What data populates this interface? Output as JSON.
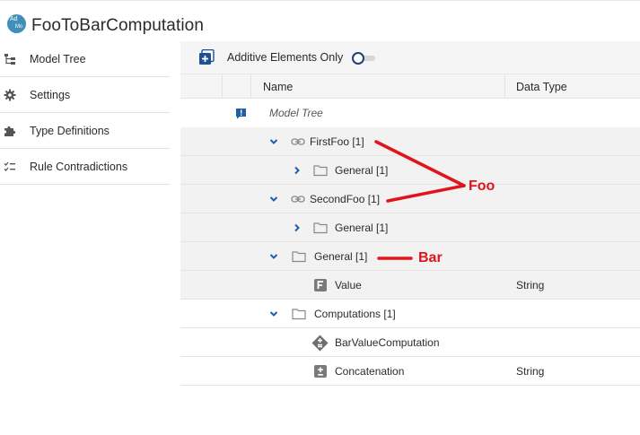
{
  "app": {
    "logo_line1": "Ad",
    "logo_line2": "Mo",
    "title": "FooToBarComputation"
  },
  "sidebar": {
    "items": [
      {
        "label": "Model Tree",
        "icon": "model-tree-icon"
      },
      {
        "label": "Settings",
        "icon": "gear-icon"
      },
      {
        "label": "Type Definitions",
        "icon": "puzzle-icon"
      },
      {
        "label": "Rule Contradictions",
        "icon": "checklist-icon"
      }
    ]
  },
  "toolbar": {
    "add_icon": "add-element-icon",
    "additive_label": "Additive Elements Only",
    "additive_enabled": false
  },
  "table": {
    "columns": {
      "name": "Name",
      "data_type": "Data Type"
    },
    "rows": [
      {
        "name": "Model Tree",
        "icon": "info-badge-icon",
        "type": ""
      },
      {
        "name": "FirstFoo [1]",
        "icon": "link-icon",
        "expander": "chevron-down-icon",
        "type": ""
      },
      {
        "name": "General [1]",
        "icon": "folder-icon",
        "expander": "chevron-right-icon",
        "type": ""
      },
      {
        "name": "SecondFoo [1]",
        "icon": "link-icon",
        "expander": "chevron-down-icon",
        "type": ""
      },
      {
        "name": "General [1]",
        "icon": "folder-icon",
        "expander": "chevron-right-icon",
        "type": ""
      },
      {
        "name": "General [1]",
        "icon": "folder-icon",
        "expander": "chevron-down-icon",
        "type": ""
      },
      {
        "name": "Value",
        "icon": "field-f-icon",
        "type": "String"
      },
      {
        "name": "Computations [1]",
        "icon": "folder-icon",
        "expander": "chevron-down-icon",
        "type": ""
      },
      {
        "name": "BarValueComputation",
        "icon": "computation-diamond-icon",
        "type": ""
      },
      {
        "name": "Concatenation",
        "icon": "plus-minus-icon",
        "type": "String"
      }
    ]
  },
  "annotations": {
    "foo_label": "Foo",
    "bar_label": "Bar",
    "color": "#e0141b"
  },
  "colors": {
    "accent_blue": "#1f5fa8",
    "toggle_border": "#1f3f7a",
    "row_shade": "#f2f2f2"
  }
}
